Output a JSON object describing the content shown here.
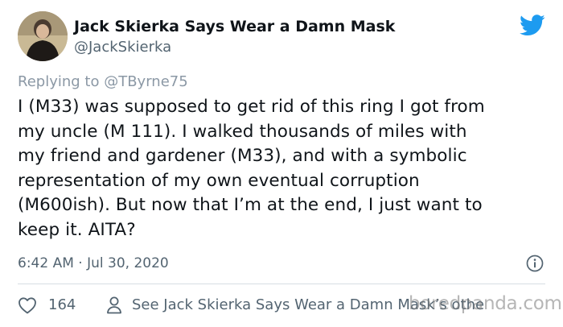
{
  "tweet": {
    "display_name": "Jack Skierka Says Wear a Damn Mask",
    "handle": "@JackSkierka",
    "reply_prefix": "Replying to ",
    "reply_to": "@TByrne75",
    "text_lines": [
      "I (M33) was supposed to get rid of this ring I got from",
      "my uncle (M 111). I walked thousands of miles with",
      "my friend and gardener (M33), and with a symbolic",
      "representation of my own eventual corruption",
      "(M600ish). But now that I’m at the end, I just want to",
      "keep it. AITA?"
    ],
    "timestamp": "6:42 AM · Jul 30, 2020",
    "like_count": "164",
    "see_more": "See Jack Skierka Says Wear a Damn Mask’s othe"
  },
  "watermark": "boredpanda.com",
  "icons": {
    "brand": "twitter-bird-icon",
    "info": "info-icon",
    "like": "heart-icon",
    "profile": "person-icon"
  },
  "colors": {
    "brand": "#1d9bf0",
    "text": "#0f1419",
    "muted": "#536471"
  }
}
